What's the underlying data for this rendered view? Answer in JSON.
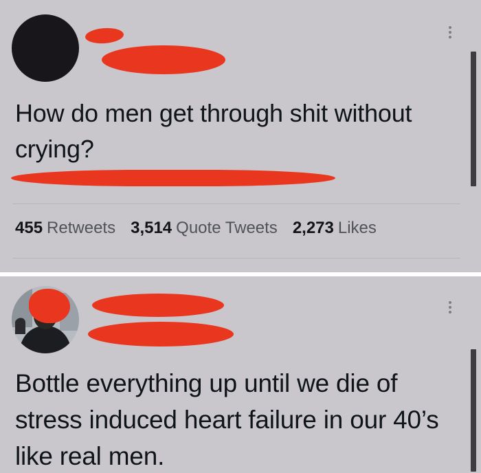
{
  "tweet_1": {
    "text": "How do men get through shit without crying?",
    "stats": [
      {
        "count": "455",
        "label": "Retweets"
      },
      {
        "count": "3,514",
        "label": "Quote Tweets"
      },
      {
        "count": "2,273",
        "label": "Likes"
      }
    ]
  },
  "tweet_2": {
    "text": "Bottle everything up until we die of stress induced heart failure in our 40’s like real men."
  },
  "colors": {
    "background": "#c9c7cc",
    "redaction": "#e8361f",
    "text": "#0f1419",
    "separator": "#ffffff"
  },
  "icons": [
    "more-options-icon",
    "avatar"
  ]
}
